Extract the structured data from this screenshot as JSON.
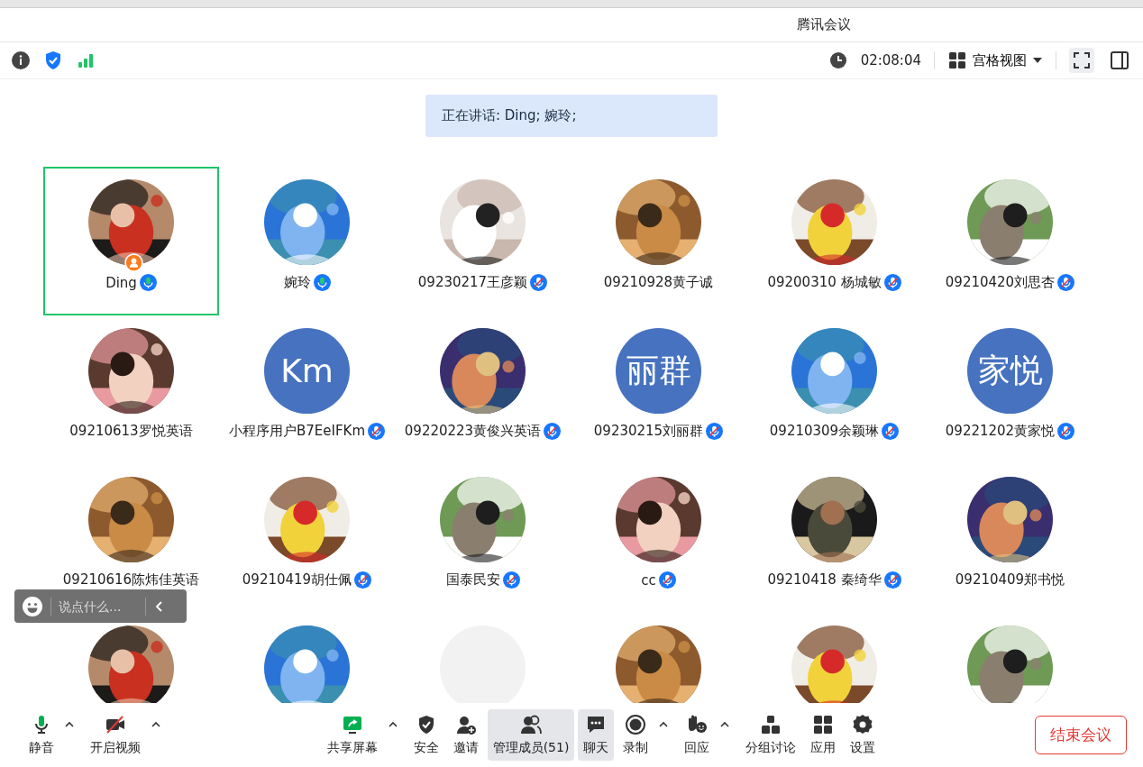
{
  "window": {
    "title": "腾讯会议"
  },
  "header": {
    "timer": "02:08:04",
    "view_mode": "宫格视图"
  },
  "speaking_banner": "正在讲话: Ding; 婉玲;",
  "participants": [
    {
      "name": "Ding",
      "kind": "picture",
      "speaking": true,
      "host": true,
      "selected": true
    },
    {
      "name": "婉玲",
      "kind": "picture",
      "speaking": true,
      "host": false,
      "selected": false
    },
    {
      "name": "09230217王彦颖",
      "kind": "picture",
      "speaking": false,
      "muted": true,
      "host": false,
      "selected": false
    },
    {
      "name": "09210928黄子诚",
      "kind": "picture",
      "speaking": false,
      "muted": false,
      "host": false,
      "selected": false
    },
    {
      "name": "09200310 杨城敏",
      "kind": "picture",
      "speaking": false,
      "muted": true,
      "host": false,
      "selected": false
    },
    {
      "name": "09210420刘思杏",
      "kind": "picture",
      "speaking": false,
      "muted": true,
      "host": false,
      "selected": false
    },
    {
      "name": "09210613罗悦英语",
      "kind": "picture",
      "speaking": false,
      "muted": false,
      "host": false,
      "selected": false
    },
    {
      "name": "小程序用户B7EeIFKm",
      "kind": "initials",
      "initials": "Km",
      "speaking": false,
      "muted": true,
      "host": false,
      "selected": false
    },
    {
      "name": "09220223黄俊兴英语",
      "kind": "picture",
      "speaking": false,
      "muted": true,
      "host": false,
      "selected": false
    },
    {
      "name": "09230215刘丽群",
      "kind": "initials",
      "initials": "丽群",
      "speaking": false,
      "muted": true,
      "host": false,
      "selected": false
    },
    {
      "name": "09210309余颖琳",
      "kind": "picture",
      "speaking": false,
      "muted": true,
      "host": false,
      "selected": false
    },
    {
      "name": "09221202黄家悦",
      "kind": "initials",
      "initials": "家悦",
      "speaking": false,
      "muted": true,
      "host": false,
      "selected": false
    },
    {
      "name": "09210616陈炜佳英语",
      "kind": "picture",
      "speaking": false,
      "muted": false,
      "host": false,
      "selected": false
    },
    {
      "name": "09210419胡仕佩",
      "kind": "picture",
      "speaking": false,
      "muted": true,
      "host": false,
      "selected": false
    },
    {
      "name": "国泰民安",
      "kind": "picture",
      "speaking": false,
      "muted": true,
      "host": false,
      "selected": false
    },
    {
      "name": "cc",
      "kind": "picture",
      "speaking": false,
      "muted": true,
      "host": false,
      "selected": false
    },
    {
      "name": "09210418 秦绮华",
      "kind": "picture",
      "speaking": false,
      "muted": true,
      "host": false,
      "selected": false
    },
    {
      "name": "09210409郑书悦",
      "kind": "picture",
      "speaking": false,
      "muted": false,
      "host": false,
      "selected": false
    },
    {
      "kind": "picture"
    },
    {
      "kind": "picture"
    },
    {
      "kind": "blank"
    },
    {
      "kind": "picture"
    },
    {
      "kind": "picture"
    },
    {
      "kind": "picture"
    }
  ],
  "chat_box": {
    "placeholder": "说点什么..."
  },
  "toolbar_left": [
    {
      "label": "静音",
      "kind": "mic",
      "caret": true,
      "selected": false
    },
    {
      "label": "开启视频",
      "kind": "video-off",
      "caret": true,
      "selected": false
    }
  ],
  "toolbar_center": [
    {
      "label": "共享屏幕",
      "kind": "share",
      "caret": true,
      "selected": false
    },
    {
      "label": "安全",
      "kind": "shield",
      "caret": false,
      "selected": false
    },
    {
      "label": "邀请",
      "kind": "invite",
      "caret": false,
      "selected": false
    },
    {
      "label": "管理成员(51)",
      "kind": "members",
      "caret": false,
      "selected": true
    },
    {
      "label": "聊天",
      "kind": "chat",
      "caret": false,
      "selected": true
    },
    {
      "label": "录制",
      "kind": "record",
      "caret": true,
      "selected": false
    },
    {
      "label": "回应",
      "kind": "reaction",
      "caret": true,
      "selected": false
    },
    {
      "label": "分组讨论",
      "kind": "breakout",
      "caret": false,
      "selected": false
    },
    {
      "label": "应用",
      "kind": "apps",
      "caret": false,
      "selected": false
    },
    {
      "label": "设置",
      "kind": "settings",
      "caret": false,
      "selected": false
    }
  ],
  "end_button": "结束会议"
}
